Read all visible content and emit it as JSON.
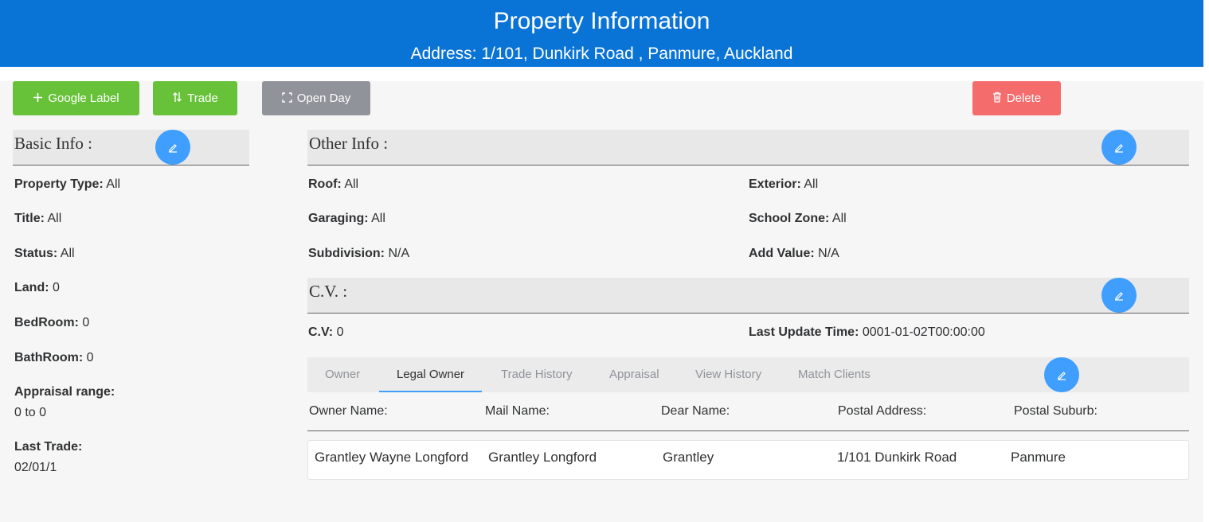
{
  "header": {
    "title": "Property Information",
    "address": "Address: 1/101, Dunkirk Road , Panmure, Auckland"
  },
  "toolbar": {
    "google_label": "Google Label",
    "trade_label": "Trade",
    "open_day_label": "Open Day",
    "delete_label": "Delete"
  },
  "basic_info": {
    "title": "Basic Info :",
    "property_type_label": "Property Type:",
    "property_type_value": "All",
    "title_label": "Title:",
    "title_value": "All",
    "status_label": "Status:",
    "status_value": "All",
    "land_label": "Land:",
    "land_value": "0",
    "bedroom_label": "BedRoom:",
    "bedroom_value": "0",
    "bathroom_label": "BathRoom:",
    "bathroom_value": "0",
    "appraisal_label": "Appraisal range:",
    "appraisal_value": "0 to 0",
    "last_trade_label": "Last Trade:",
    "last_trade_value": "02/01/1"
  },
  "other_info": {
    "title": "Other Info :",
    "roof_label": "Roof:",
    "roof_value": "All",
    "exterior_label": "Exterior:",
    "exterior_value": "All",
    "garaging_label": "Garaging:",
    "garaging_value": "All",
    "school_zone_label": "School Zone:",
    "school_zone_value": "All",
    "subdivision_label": "Subdivision:",
    "subdivision_value": "N/A",
    "add_value_label": "Add Value:",
    "add_value_value": "N/A"
  },
  "cv": {
    "title": "C.V. :",
    "cv_label": "C.V:",
    "cv_value": "0",
    "last_update_label": "Last Update Time:",
    "last_update_value": "0001-01-02T00:00:00"
  },
  "tabs": [
    {
      "label": "Owner"
    },
    {
      "label": "Legal Owner"
    },
    {
      "label": "Trade History"
    },
    {
      "label": "Appraisal"
    },
    {
      "label": "View History"
    },
    {
      "label": "Match Clients"
    }
  ],
  "active_tab": "Legal Owner",
  "table": {
    "headers": [
      "Owner Name:",
      "Mail Name:",
      "Dear Name:",
      "Postal Address:",
      "Postal Suburb:"
    ],
    "rows": [
      [
        "Grantley Wayne Longford",
        "Grantley Longford",
        "Grantley",
        "1/101 Dunkirk Road",
        "Panmure"
      ]
    ]
  },
  "colors": {
    "header_bg": "#0a74d6",
    "green_button": "#67c23a",
    "gray_button": "#909399",
    "delete_button": "#f56c6c",
    "edit_button": "#409eff",
    "active_tab_underline": "#409eff"
  },
  "icons": {
    "google_label": "plus-icon",
    "trade": "swap-icon",
    "open_day": "fullscreen-icon",
    "delete": "trash-icon",
    "edit": "edit-pen-icon"
  }
}
